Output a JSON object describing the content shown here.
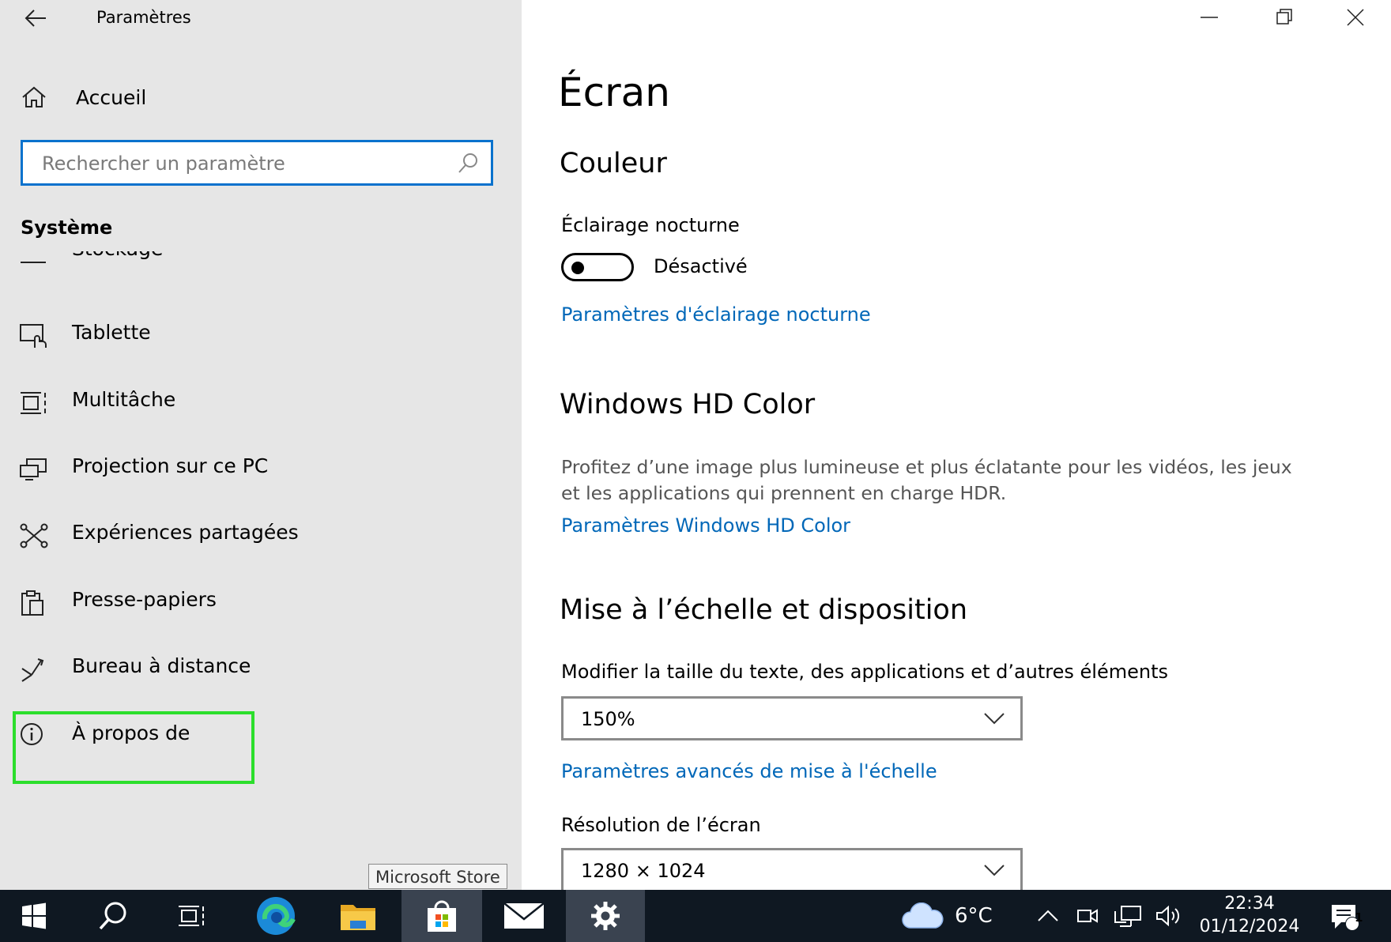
{
  "window": {
    "title": "Paramètres",
    "controls": [
      "minimize",
      "restore",
      "close"
    ]
  },
  "sidebar": {
    "home_label": "Accueil",
    "search_placeholder": "Rechercher un paramètre",
    "section_title": "Système",
    "items": [
      {
        "label": "Stockage",
        "icon": "storage-icon"
      },
      {
        "label": "Tablette",
        "icon": "tablet-icon"
      },
      {
        "label": "Multitâche",
        "icon": "multitasking-icon"
      },
      {
        "label": "Projection sur ce PC",
        "icon": "projection-icon"
      },
      {
        "label": "Expériences partagées",
        "icon": "shared-experiences-icon"
      },
      {
        "label": "Presse-papiers",
        "icon": "clipboard-icon"
      },
      {
        "label": "Bureau à distance",
        "icon": "remote-desktop-icon"
      },
      {
        "label": "À propos de",
        "icon": "info-icon"
      }
    ],
    "focused_item": "À propos de"
  },
  "main": {
    "title": "Écran",
    "color_heading": "Couleur",
    "night_light_label": "Éclairage nocturne",
    "night_light_state": "Désactivé",
    "night_light_on": false,
    "night_light_link": "Paramètres d'éclairage nocturne",
    "hd_heading": "Windows HD Color",
    "hd_description": "Profitez d’une image plus lumineuse et plus éclatante pour les vidéos, les jeux et les applications qui prennent en charge HDR.",
    "hd_link": "Paramètres Windows HD Color",
    "scale_heading": "Mise à l’échelle et disposition",
    "scale_label": "Modifier la taille du texte, des applications et d’autres éléments",
    "scale_value": "150%",
    "advanced_scale_link": "Paramètres avancés de mise à l'échelle",
    "resolution_label": "Résolution de l’écran",
    "resolution_value": "1280 × 1024"
  },
  "tooltip": "Microsoft Store",
  "taskbar": {
    "apps": [
      "start-icon",
      "search-icon",
      "task-view-icon",
      "edge-icon",
      "file-explorer-icon",
      "store-icon",
      "mail-icon",
      "settings-icon"
    ],
    "active_app": "settings-icon",
    "weather_temp": "6°C",
    "time": "22:34",
    "date": "01/12/2024",
    "notification_count": "1"
  },
  "colors": {
    "sidebar_bg": "#e6e6e6",
    "accent": "#0067b8",
    "search_border": "#0a72cd",
    "focus_highlight": "#2cde2c",
    "taskbar_bg": "#0f1822"
  }
}
